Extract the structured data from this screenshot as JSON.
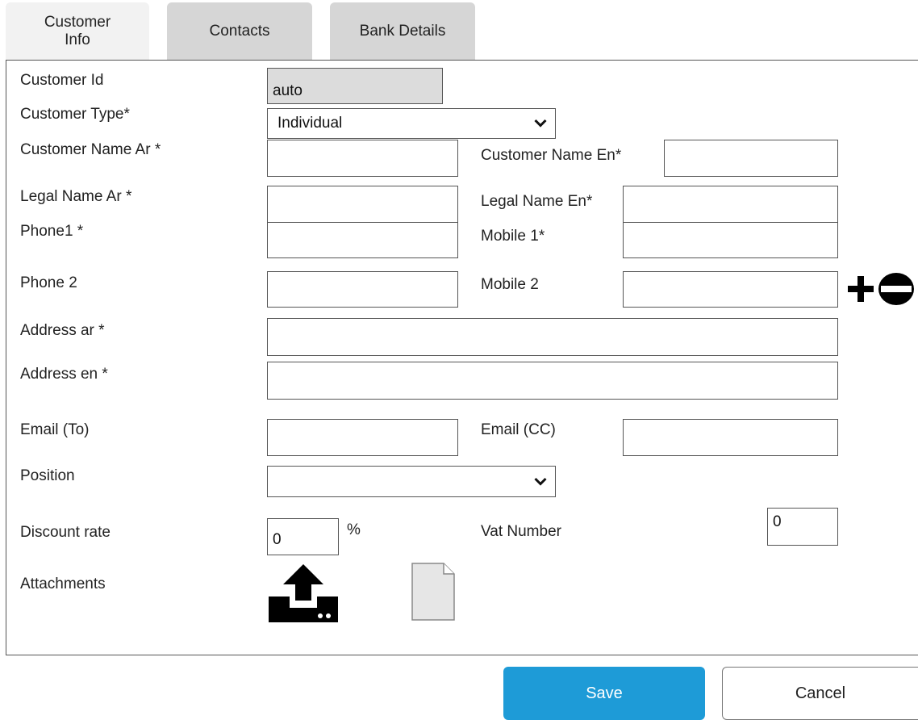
{
  "tabs": [
    {
      "label": "Customer\nInfo",
      "active": true
    },
    {
      "label": "Contacts",
      "active": false
    },
    {
      "label": "Bank Details",
      "active": false
    }
  ],
  "form": {
    "customer_id": {
      "label": "Customer Id",
      "value": "auto"
    },
    "customer_type": {
      "label": "Customer Type*",
      "value": "Individual"
    },
    "customer_name_ar": {
      "label": "Customer Name Ar *",
      "value": ""
    },
    "customer_name_en": {
      "label": "Customer Name En*",
      "value": ""
    },
    "legal_name_ar": {
      "label": "Legal Name Ar *",
      "value": ""
    },
    "legal_name_en": {
      "label": "Legal Name En*",
      "value": ""
    },
    "phone1": {
      "label": "Phone1 *",
      "value": ""
    },
    "mobile1": {
      "label": "Mobile 1*",
      "value": ""
    },
    "phone2": {
      "label": "Phone 2",
      "value": ""
    },
    "mobile2": {
      "label": "Mobile 2",
      "value": ""
    },
    "address_ar": {
      "label": "Address ar *",
      "value": ""
    },
    "address_en": {
      "label": "Address en *",
      "value": ""
    },
    "email_to": {
      "label": "Email (To)",
      "value": ""
    },
    "email_cc": {
      "label": "Email (CC)",
      "value": ""
    },
    "position": {
      "label": "Position",
      "value": ""
    },
    "discount_rate": {
      "label": "Discount rate",
      "value": "0",
      "unit": "%"
    },
    "vat_number": {
      "label": "Vat Number",
      "value": "0"
    },
    "attachments": {
      "label": "Attachments"
    }
  },
  "buttons": {
    "save": "Save",
    "cancel": "Cancel"
  },
  "icons": {
    "add_mobile": "plus-icon",
    "remove_mobile": "minus-circle-icon",
    "upload": "upload-icon",
    "file": "file-icon"
  },
  "colors": {
    "save_button": "#1e9bd7",
    "readonly_field": "#dcdcdc",
    "tab_inactive": "#d6d6d6",
    "tab_active": "#f2f2f2"
  }
}
